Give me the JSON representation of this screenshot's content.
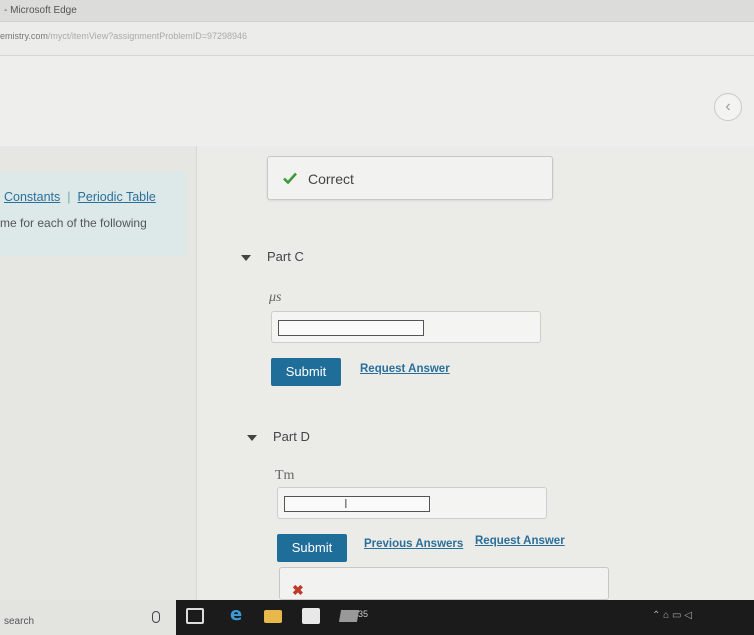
{
  "window": {
    "title": "- Microsoft Edge"
  },
  "address": {
    "url_main": "emistry.com",
    "url_rest": "/myct/itemView?assignmentProblemID=97298946"
  },
  "nav": {
    "back_glyph": "‹"
  },
  "sidebar": {
    "links": [
      {
        "label": "Constants"
      },
      {
        "label": "Periodic Table"
      }
    ],
    "separator": "|",
    "instruction": "me for each of the following"
  },
  "feedback": {
    "correct_label": "Correct"
  },
  "parts": [
    {
      "title": "Part C",
      "unit": "μs",
      "input_value": "",
      "submit_label": "Submit",
      "links": [
        "Request Answer"
      ]
    },
    {
      "title": "Part D",
      "unit": "Tm",
      "input_value": "",
      "submit_label": "Submit",
      "links": [
        "Previous Answers",
        "Request Answer"
      ]
    }
  ],
  "taskbar": {
    "search_label": "search",
    "mail_badge": "35"
  },
  "colors": {
    "accent": "#1f6d99",
    "link": "#2a6f9a",
    "correct_check": "#3c9a3c"
  }
}
